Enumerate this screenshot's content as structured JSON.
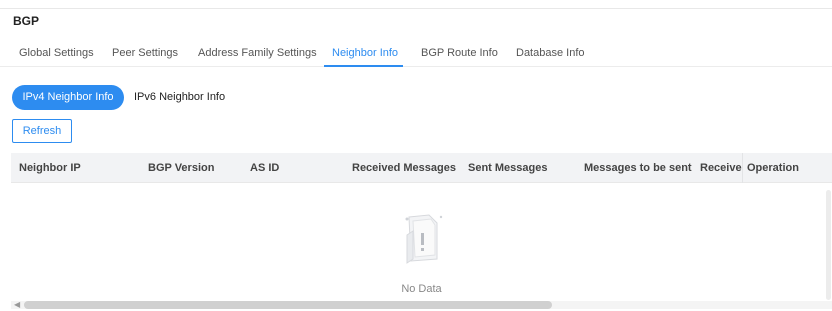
{
  "header": {
    "title": "BGP"
  },
  "tabs": [
    {
      "label": "Global Settings"
    },
    {
      "label": "Peer Settings"
    },
    {
      "label": "Address Family Settings"
    },
    {
      "label": "Neighbor Info"
    },
    {
      "label": "BGP Route Info"
    },
    {
      "label": "Database Info"
    }
  ],
  "active_tab": "Neighbor Info",
  "subtabs": [
    {
      "label": "IPv4 Neighbor Info"
    },
    {
      "label": "IPv6 Neighbor Info"
    }
  ],
  "toolbar": {
    "refresh_label": "Refresh"
  },
  "table": {
    "columns": [
      "Neighbor IP",
      "BGP Version",
      "AS ID",
      "Received Messages",
      "Sent Messages",
      "Messages to be sent",
      "Receivec",
      "Operation"
    ],
    "empty_text": "No Data"
  },
  "colors": {
    "accent": "#2d8cf0",
    "header_bg": "#f2f3f5"
  },
  "icons": {
    "empty": "empty-document-icon",
    "scroll_left": "arrow-left-icon"
  }
}
